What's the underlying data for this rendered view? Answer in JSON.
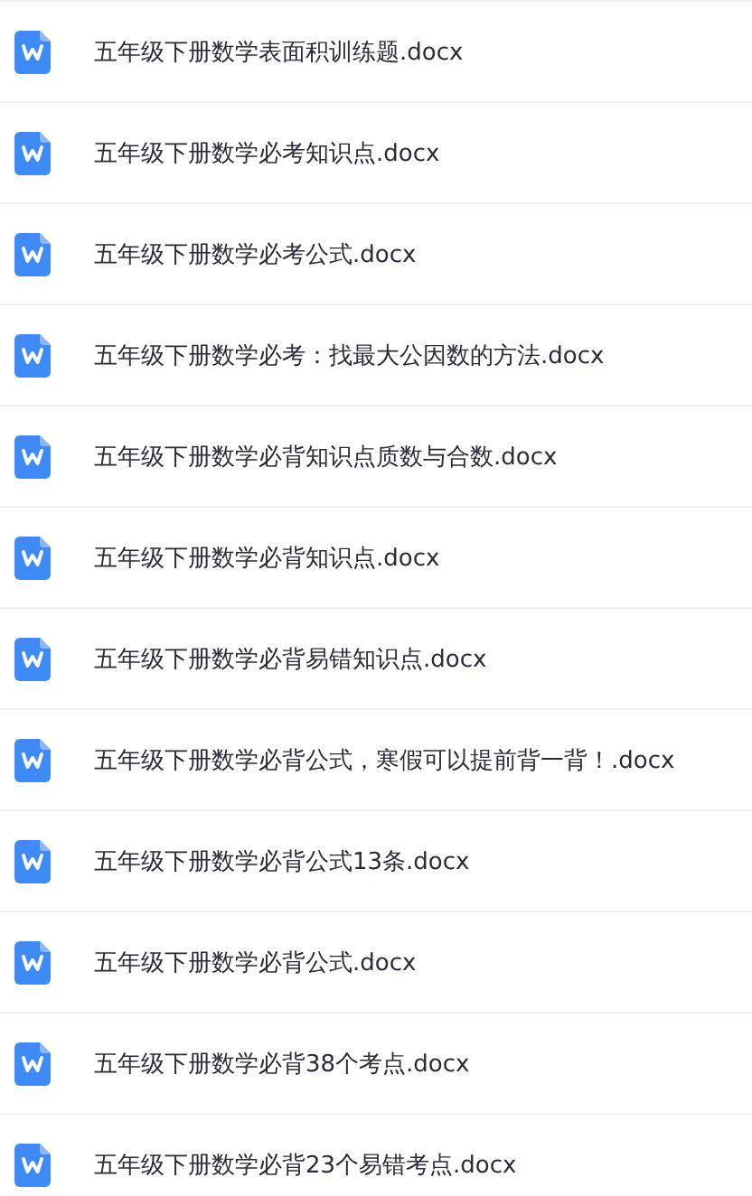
{
  "files": [
    {
      "name": "五年级下册数学表面积训练题.docx"
    },
    {
      "name": "五年级下册数学必考知识点.docx"
    },
    {
      "name": "五年级下册数学必考公式.docx"
    },
    {
      "name": "五年级下册数学必考：找最大公因数的方法.docx"
    },
    {
      "name": "五年级下册数学必背知识点质数与合数.docx"
    },
    {
      "name": "五年级下册数学必背知识点.docx"
    },
    {
      "name": "五年级下册数学必背易错知识点.docx"
    },
    {
      "name": "五年级下册数学必背公式，寒假可以提前背一背！.docx"
    },
    {
      "name": "五年级下册数学必背公式13条.docx"
    },
    {
      "name": "五年级下册数学必背公式.docx"
    },
    {
      "name": "五年级下册数学必背38个考点.docx"
    },
    {
      "name": "五年级下册数学必背23个易错考点.docx"
    }
  ]
}
